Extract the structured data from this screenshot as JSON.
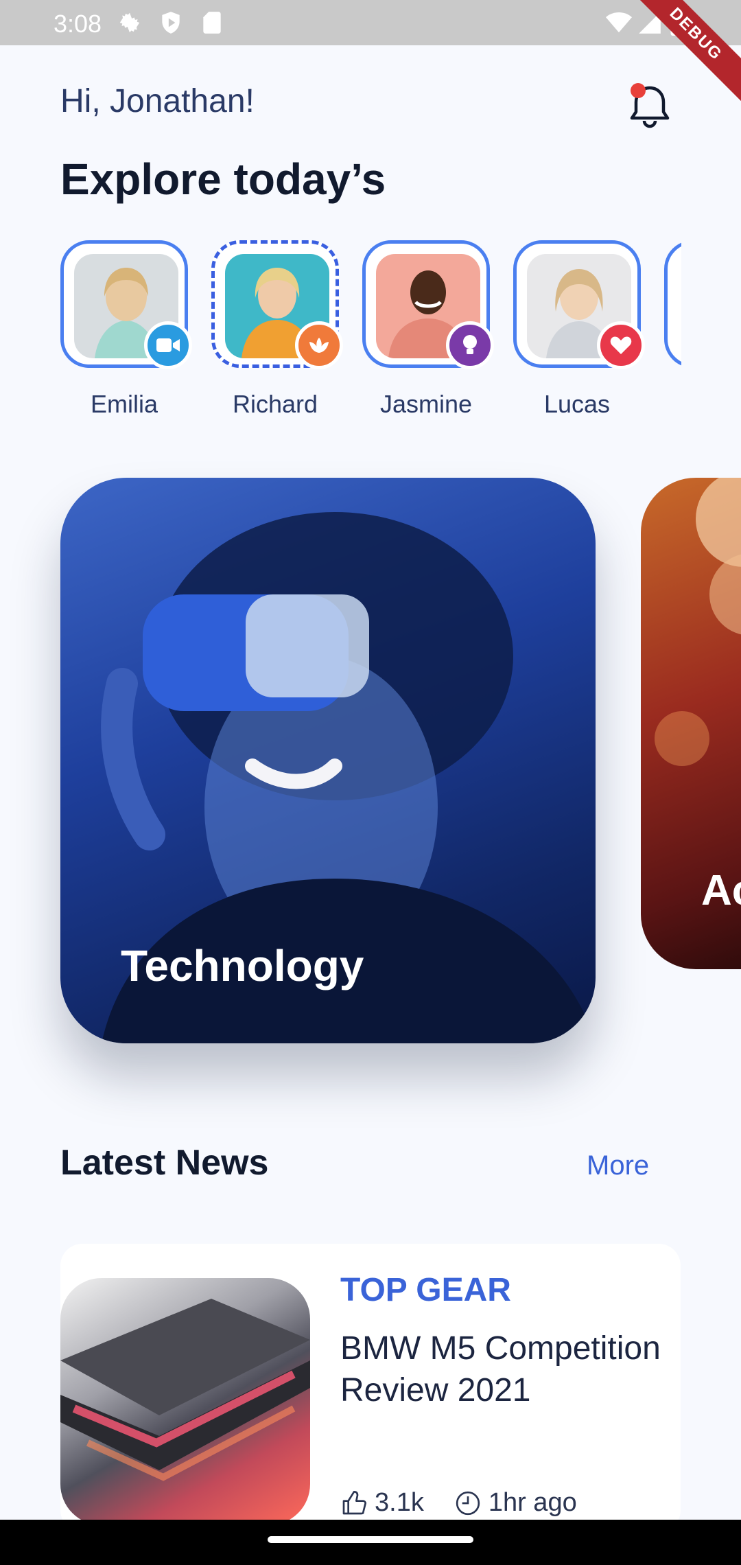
{
  "status_bar": {
    "time": "3:08",
    "debug_label": "DEBUG"
  },
  "header": {
    "greeting": "Hi, Jonathan!",
    "headline": "Explore today’s"
  },
  "stories": [
    {
      "name": "Emilia",
      "badge_icon": "video-camera-icon",
      "badge_color": "#2a9be0",
      "ring": "solid"
    },
    {
      "name": "Richard",
      "badge_icon": "lotus-icon",
      "badge_color": "#f07a3a",
      "ring": "dashed"
    },
    {
      "name": "Jasmine",
      "badge_icon": "lightbulb-icon",
      "badge_color": "#7a3aa8",
      "ring": "solid"
    },
    {
      "name": "Lucas",
      "badge_icon": "heart-icon",
      "badge_color": "#e8384a",
      "ring": "solid"
    }
  ],
  "cards": [
    {
      "title": "Technology"
    },
    {
      "title": "Ac"
    }
  ],
  "latest_news": {
    "title": "Latest News",
    "more_label": "More",
    "items": [
      {
        "category": "TOP GEAR",
        "headline": "BMW M5 Competition Review 2021",
        "likes": "3.1k",
        "time": "1hr ago"
      }
    ]
  },
  "colors": {
    "accent": "#3a63d8",
    "background": "#f7f9fe"
  }
}
